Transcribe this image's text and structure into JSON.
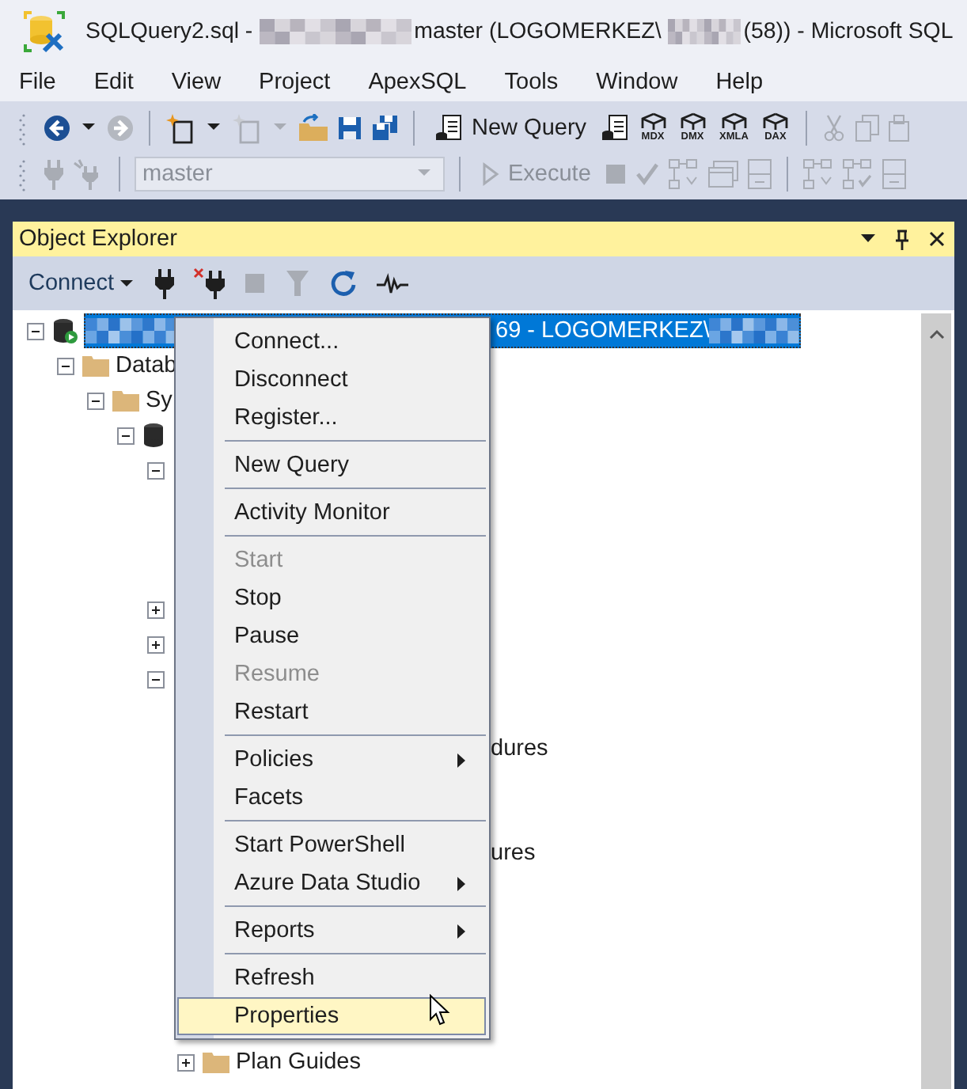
{
  "title_bar": {
    "parts": [
      {
        "kind": "text",
        "text": "SQLQuery2.sql -"
      },
      {
        "kind": "redacted"
      },
      {
        "kind": "text",
        "text": "master (LOGOMERKEZ\\"
      },
      {
        "kind": "redacted"
      },
      {
        "kind": "text",
        "text": "(58)) - Microsoft SQL"
      }
    ]
  },
  "menu_bar": [
    "File",
    "Edit",
    "View",
    "Project",
    "ApexSQL",
    "Tools",
    "Window",
    "Help"
  ],
  "toolbar_1": [
    {
      "kind": "grip"
    },
    {
      "kind": "back",
      "disabled": false
    },
    {
      "kind": "caret",
      "disabled": false
    },
    {
      "kind": "forward",
      "disabled": true
    },
    {
      "kind": "sep"
    },
    {
      "kind": "newproject",
      "disabled": false
    },
    {
      "kind": "caret",
      "disabled": false
    },
    {
      "kind": "additem",
      "disabled": true
    },
    {
      "kind": "caret",
      "disabled": true
    },
    {
      "kind": "open",
      "disabled": false
    },
    {
      "kind": "save",
      "disabled": false
    },
    {
      "kind": "saveall",
      "disabled": false
    },
    {
      "kind": "sep"
    },
    {
      "kind": "newquery",
      "label": "New Query",
      "disabled": false
    },
    {
      "kind": "dbquery",
      "disabled": false
    },
    {
      "kind": "cube",
      "label": "MDX",
      "disabled": false
    },
    {
      "kind": "cube",
      "label": "DMX",
      "disabled": false
    },
    {
      "kind": "cube",
      "label": "XMLA",
      "disabled": false
    },
    {
      "kind": "cube",
      "label": "DAX",
      "disabled": false
    },
    {
      "kind": "sep"
    },
    {
      "kind": "cut",
      "disabled": true
    },
    {
      "kind": "copy",
      "disabled": true
    },
    {
      "kind": "paste",
      "disabled": true
    }
  ],
  "toolbar_2": [
    {
      "kind": "grip"
    },
    {
      "kind": "plug",
      "disabled": true
    },
    {
      "kind": "changeconn",
      "disabled": true
    },
    {
      "kind": "sep"
    },
    {
      "kind": "dbselect",
      "value": "master",
      "disabled": true
    },
    {
      "kind": "sep"
    },
    {
      "kind": "execute",
      "label": "Execute",
      "disabled": true
    },
    {
      "kind": "stop",
      "disabled": true
    },
    {
      "kind": "check",
      "disabled": true
    },
    {
      "kind": "plan",
      "disabled": true
    },
    {
      "kind": "window",
      "disabled": true
    },
    {
      "kind": "form",
      "disabled": true
    },
    {
      "kind": "sep"
    },
    {
      "kind": "plan",
      "disabled": true
    },
    {
      "kind": "plancheck",
      "disabled": true
    },
    {
      "kind": "form",
      "disabled": true
    }
  ],
  "object_explorer": {
    "title": "Object Explorer",
    "toolbar": [
      {
        "kind": "connect",
        "label": "Connect",
        "disabled": false
      },
      {
        "kind": "plug",
        "disabled": false
      },
      {
        "kind": "disconnect",
        "disabled": false
      },
      {
        "kind": "stop",
        "disabled": true
      },
      {
        "kind": "filter",
        "disabled": true
      },
      {
        "kind": "refresh",
        "disabled": false
      },
      {
        "kind": "activity",
        "disabled": false
      }
    ],
    "tree": [
      {
        "kind": "server",
        "label": "69 - LOGOMERKEZ\\",
        "selected": true,
        "expanded": true,
        "children": [
          {
            "kind": "folder",
            "label": "Datab",
            "expanded": true,
            "children": [
              {
                "kind": "folder",
                "label": "Sy",
                "expanded": true,
                "children": [
                  {
                    "kind": "database",
                    "expanded": true,
                    "children": [
                      {
                        "expanded": true,
                        "children": [
                          {
                            "covered": true
                          },
                          {
                            "covered": true
                          },
                          {
                            "covered": true
                          }
                        ]
                      },
                      {
                        "expanded": false
                      },
                      {
                        "expanded": false
                      },
                      {
                        "expanded": true,
                        "children": [
                          {
                            "covered": true
                          },
                          {
                            "kind": "tail",
                            "label": "dures"
                          },
                          {
                            "covered": true
                          },
                          {
                            "covered": true
                          },
                          {
                            "kind": "tail",
                            "label": "ures"
                          },
                          {
                            "covered": true
                          },
                          {
                            "covered": true
                          },
                          {
                            "covered": true
                          },
                          {
                            "covered": true
                          },
                          {
                            "covered": true
                          },
                          {
                            "kind": "folder",
                            "label": "Plan Guides",
                            "expanded": false
                          }
                        ]
                      }
                    ]
                  }
                ]
              }
            ]
          }
        ]
      }
    ]
  },
  "context_menu": [
    {
      "kind": "item",
      "label": "Connect...",
      "disabled": false,
      "submenu": false,
      "selected": false
    },
    {
      "kind": "item",
      "label": "Disconnect",
      "disabled": false,
      "submenu": false,
      "selected": false
    },
    {
      "kind": "item",
      "label": "Register...",
      "disabled": false,
      "submenu": false,
      "selected": false
    },
    {
      "kind": "separator"
    },
    {
      "kind": "item",
      "label": "New Query",
      "disabled": false,
      "submenu": false,
      "selected": false
    },
    {
      "kind": "separator"
    },
    {
      "kind": "item",
      "label": "Activity Monitor",
      "disabled": false,
      "submenu": false,
      "selected": false
    },
    {
      "kind": "separator"
    },
    {
      "kind": "item",
      "label": "Start",
      "disabled": true,
      "submenu": false,
      "selected": false
    },
    {
      "kind": "item",
      "label": "Stop",
      "disabled": false,
      "submenu": false,
      "selected": false
    },
    {
      "kind": "item",
      "label": "Pause",
      "disabled": false,
      "submenu": false,
      "selected": false
    },
    {
      "kind": "item",
      "label": "Resume",
      "disabled": true,
      "submenu": false,
      "selected": false
    },
    {
      "kind": "item",
      "label": "Restart",
      "disabled": false,
      "submenu": false,
      "selected": false
    },
    {
      "kind": "separator"
    },
    {
      "kind": "item",
      "label": "Policies",
      "disabled": false,
      "submenu": true,
      "selected": false
    },
    {
      "kind": "item",
      "label": "Facets",
      "disabled": false,
      "submenu": false,
      "selected": false
    },
    {
      "kind": "separator"
    },
    {
      "kind": "item",
      "label": "Start PowerShell",
      "disabled": false,
      "submenu": false,
      "selected": false
    },
    {
      "kind": "item",
      "label": "Azure Data Studio",
      "disabled": false,
      "submenu": true,
      "selected": false
    },
    {
      "kind": "separator"
    },
    {
      "kind": "item",
      "label": "Reports",
      "disabled": false,
      "submenu": true,
      "selected": false
    },
    {
      "kind": "separator"
    },
    {
      "kind": "item",
      "label": "Refresh",
      "disabled": false,
      "submenu": false,
      "selected": false
    },
    {
      "kind": "item",
      "label": "Properties",
      "disabled": false,
      "submenu": false,
      "selected": true
    }
  ]
}
